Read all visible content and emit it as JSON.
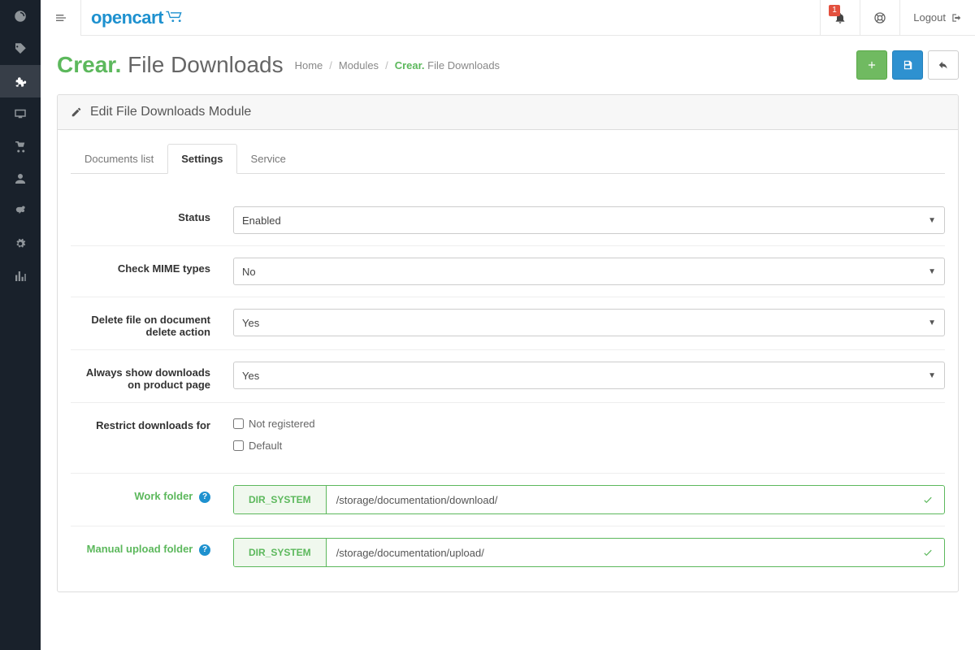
{
  "logo": "opencart",
  "notification_count": "1",
  "logout_label": "Logout",
  "page_title_brand": "Crear.",
  "page_title_rest": " File Downloads",
  "breadcrumb": {
    "home": "Home",
    "modules": "Modules",
    "current_brand": "Crear.",
    "current_rest": " File Downloads"
  },
  "panel_heading": "Edit File Downloads Module",
  "tabs": {
    "documents": "Documents list",
    "settings": "Settings",
    "service": "Service"
  },
  "fields": {
    "status": {
      "label": "Status",
      "value": "Enabled"
    },
    "mime": {
      "label": "Check MIME types",
      "value": "No"
    },
    "delete_file": {
      "label": "Delete file on document delete action",
      "value": "Yes"
    },
    "always_show": {
      "label": "Always show downloads on product page",
      "value": "Yes"
    },
    "restrict": {
      "label": "Restrict downloads for",
      "opt1": "Not registered",
      "opt2": "Default"
    },
    "work_folder": {
      "label": "Work folder",
      "prefix": "DIR_SYSTEM",
      "value": "/storage/documentation/download/"
    },
    "upload_folder": {
      "label": "Manual upload folder",
      "prefix": "DIR_SYSTEM",
      "value": "/storage/documentation/upload/"
    }
  }
}
